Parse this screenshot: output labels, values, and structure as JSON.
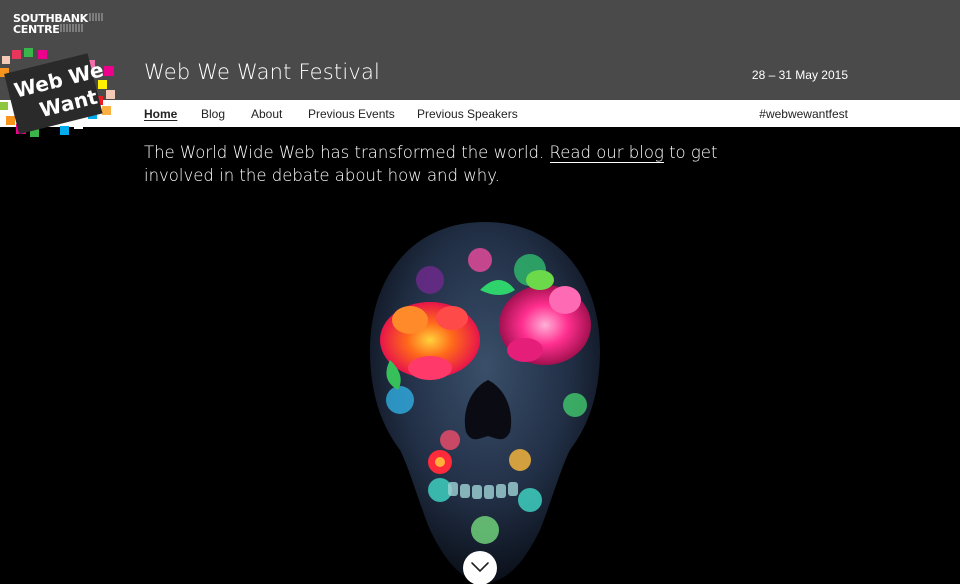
{
  "brand": {
    "org_line1": "SOUTHBANK",
    "org_line2": "CENTRE",
    "logo_line1": "Web We",
    "logo_line2": "Want"
  },
  "header": {
    "title": "Web We Want Festival",
    "dates": "28 – 31 May 2015"
  },
  "nav": {
    "items": [
      {
        "label": "Home",
        "active": true
      },
      {
        "label": "Blog",
        "active": false
      },
      {
        "label": "About",
        "active": false
      },
      {
        "label": "Previous Events",
        "active": false
      },
      {
        "label": "Previous Speakers",
        "active": false
      }
    ],
    "hashtag": "#webwewantfest"
  },
  "intro": {
    "text_before": "The World Wide Web has transformed the world. ",
    "link": "Read our blog",
    "text_after": " to get involved in the debate about how and why."
  },
  "hero": {
    "icon": "scroll-down-chevron-icon"
  },
  "colors": {
    "header_bg": "#4a4a4a",
    "page_bg": "#000000",
    "nav_bg": "#ffffff"
  }
}
